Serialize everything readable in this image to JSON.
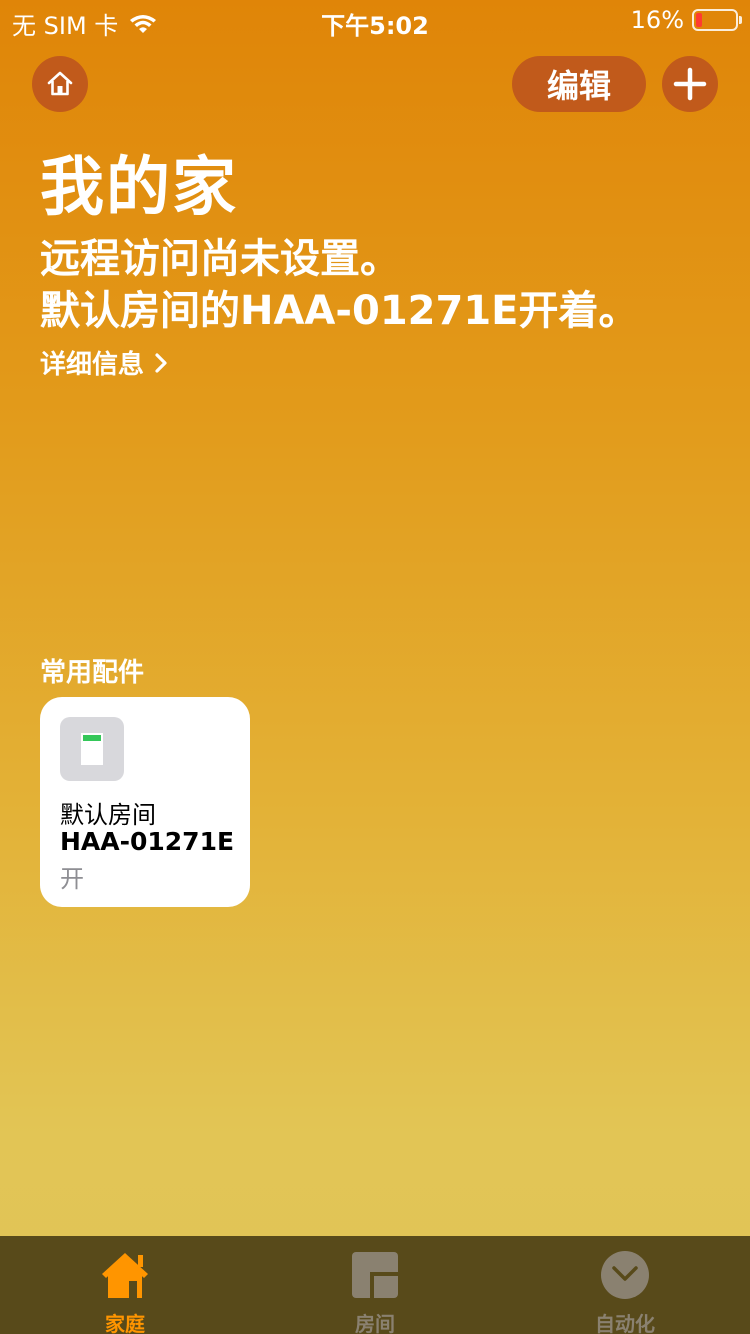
{
  "status_bar": {
    "carrier": "无 SIM 卡",
    "time": "下午5:02",
    "battery": "16%",
    "battery_level": 0.16
  },
  "header": {
    "edit_label": "编辑",
    "title": "我的家",
    "status_lines": [
      "远程访问尚未设置。",
      "默认房间的HAA-01271E开着。"
    ],
    "details_label": "详细信息"
  },
  "favorites": {
    "section_title": "常用配件",
    "accessories": [
      {
        "room": "默认房间",
        "name": "HAA-01271E",
        "state": "开",
        "icon": "switch-icon"
      }
    ]
  },
  "tab_bar": {
    "tabs": [
      {
        "label": "家庭",
        "icon": "house-icon",
        "active": true
      },
      {
        "label": "房间",
        "icon": "rooms-icon",
        "active": false
      },
      {
        "label": "自动化",
        "icon": "automation-icon",
        "active": false
      }
    ]
  },
  "colors": {
    "accent": "#FF9500",
    "button_bg": "#C15A1B",
    "tab_bar_bg": "#584A1A",
    "inactive_tab": "#8A8170",
    "switch_on": "#34C759"
  }
}
